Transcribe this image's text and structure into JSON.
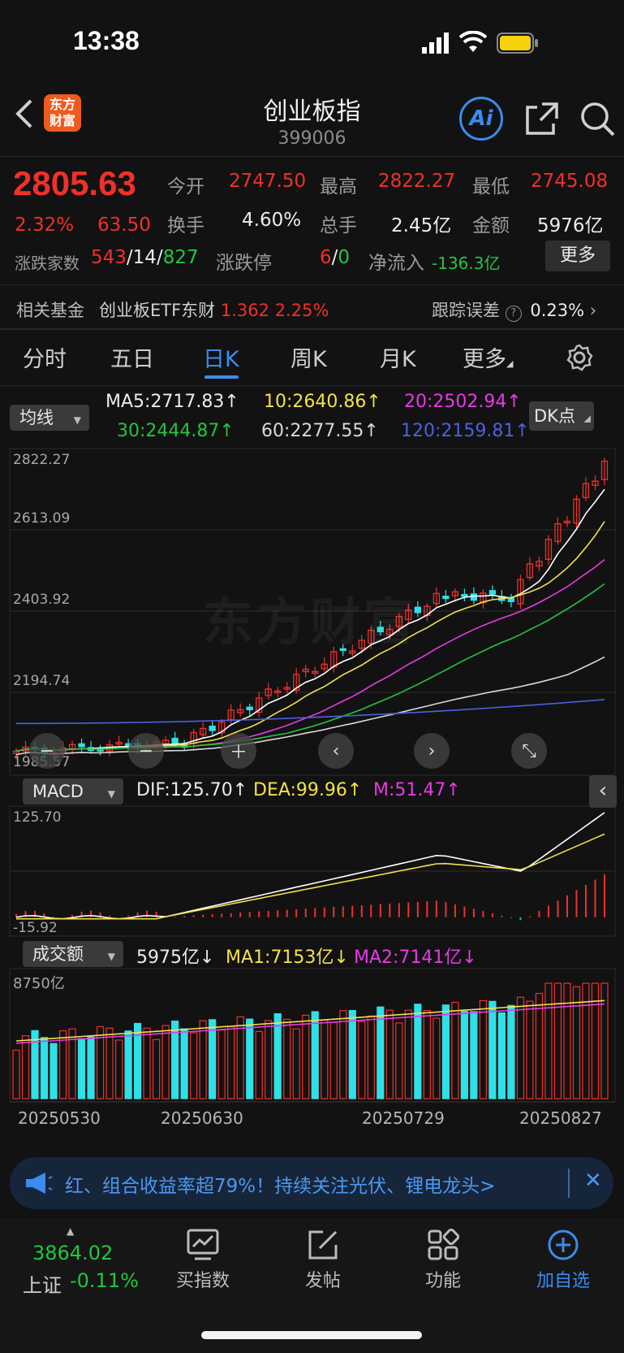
{
  "status_bar": {
    "time": "13:38"
  },
  "header": {
    "logo_text_1": "东方",
    "logo_text_2": "财富",
    "title": "创业板指",
    "code": "399006",
    "ai_label": "Ai"
  },
  "quote": {
    "price": "2805.63",
    "change_pct": "2.32%",
    "change_val": "63.50",
    "open_label": "今开",
    "open_val": "2747.50",
    "high_label": "最高",
    "high_val": "2822.27",
    "low_label": "最低",
    "low_val": "2745.08",
    "turnover_label": "换手",
    "turnover_val": "4.60%",
    "volume_label": "总手",
    "volume_val": "2.45亿",
    "amount_label": "金额",
    "amount_val": "5976亿",
    "updown_label": "涨跌家数",
    "up_count": "543",
    "flat_count": "14",
    "down_count": "827",
    "limit_label": "涨跌停",
    "limit_up": "6",
    "limit_down": "0",
    "netflow_label": "净流入",
    "netflow_val": "-136.3亿",
    "more_label": "更多"
  },
  "fund": {
    "label": "相关基金",
    "name": "创业板ETF东财",
    "price": "1.362",
    "pct": "2.25%",
    "tracking_label": "跟踪误差",
    "tracking_val": "0.23%"
  },
  "tabs": [
    "分时",
    "五日",
    "日K",
    "周K",
    "月K",
    "更多"
  ],
  "active_tab": "日K",
  "ma_panel": {
    "select_label": "均线",
    "ma5": "MA5:2717.83↑",
    "ma10": "10:2640.86↑",
    "ma20": "20:2502.94↑",
    "ma30": "30:2444.87↑",
    "ma60": "60:2277.55↑",
    "ma120": "120:2159.81↑",
    "dk_label": "DK点"
  },
  "kline": {
    "y_labels": [
      "2822.27",
      "2613.09",
      "2403.92",
      "2194.74",
      "1985.57"
    ],
    "watermark": "东方财富"
  },
  "macd": {
    "select_label": "MACD",
    "dif": "DIF:125.70↑",
    "dea": "DEA:99.96↑",
    "m": "M:51.47↑",
    "y_top": "125.70",
    "y_bottom": "-15.92"
  },
  "volume": {
    "select_label": "成交额",
    "val": "5975亿↓",
    "ma1": "MA1:7153亿↓",
    "ma2": "MA2:7141亿↓",
    "y_top": "8750亿"
  },
  "x_labels": [
    "20250530",
    "20250630",
    "20250729",
    "20250827"
  ],
  "banner": {
    "text": "红、组合收益率超79%！持续关注光伏、锂电龙头>"
  },
  "bottom": {
    "index_price": "3864.02",
    "index_name": "上证",
    "index_pct": "-0.11%",
    "items": [
      "买指数",
      "发帖",
      "功能",
      "加自选"
    ]
  },
  "colors": {
    "up": "#f1302b",
    "down": "#22c640",
    "cyan_bar": "#2fe0e6",
    "accent": "#3a8cf0",
    "ma5": "#ffffff",
    "ma10": "#f3e14a",
    "ma20": "#e63ae6",
    "ma30": "#22c640",
    "ma60": "#d9d9d9",
    "ma120": "#4a62e0"
  },
  "chart_data": {
    "type": "candlestick",
    "x_range": [
      "20250530",
      "20250827"
    ],
    "ylim": [
      1985.57,
      2822.27
    ],
    "recent_close": 2805.63,
    "moving_averages": {
      "MA5": 2717.83,
      "MA10": 2640.86,
      "MA20": 2502.94,
      "MA30": 2444.87,
      "MA60": 2277.55,
      "MA120": 2159.81
    },
    "macd": {
      "DIF": 125.7,
      "DEA": 99.96,
      "M": 51.47,
      "ylim": [
        -15.92,
        125.7
      ]
    },
    "turnover": {
      "latest": "5975亿",
      "MA1": "7153亿",
      "MA2": "7141亿",
      "ymax": "8750亿"
    }
  }
}
